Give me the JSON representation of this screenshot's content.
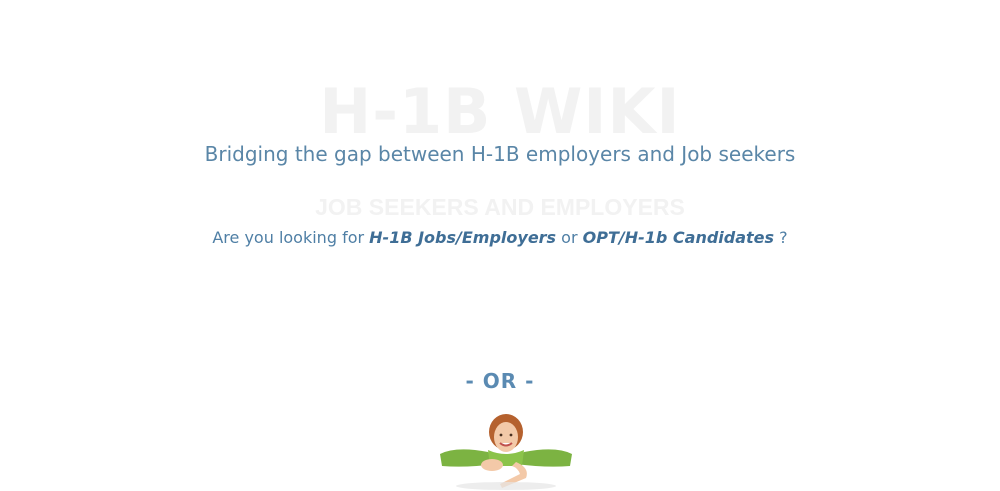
{
  "hero": {
    "title": "H-1B WIKI",
    "tagline": "Bridging the gap between H-1B employers and Job seekers"
  },
  "section": {
    "heading": "JOB SEEKERS AND EMPLOYERS",
    "question_prefix": "Are you looking for ",
    "link_jobs": "H-1B Jobs/Employers",
    "question_middle": " or ",
    "link_candidates": "OPT/H-1b Candidates",
    "question_suffix": " ?"
  },
  "divider": {
    "label": "- OR -"
  },
  "colors": {
    "accent": "#4f7fa5",
    "link": "#3f6e96",
    "faded_heading": "#f2f2f2",
    "mascot_shirt": "#7cb342"
  },
  "images": {
    "mascot": "woman-pointing-down-illustration"
  }
}
